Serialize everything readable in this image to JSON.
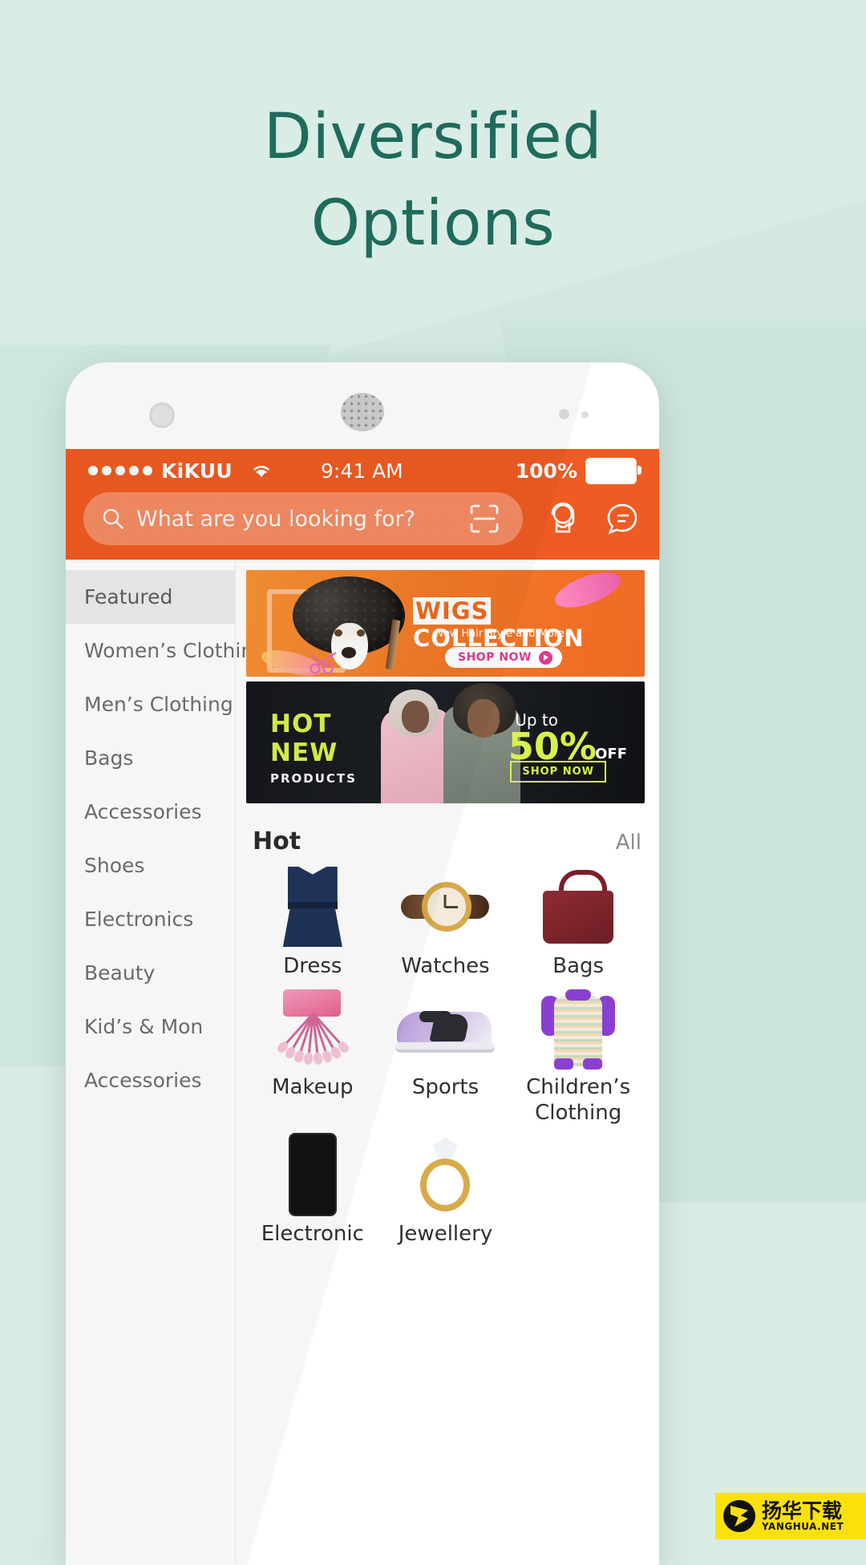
{
  "promo": {
    "headline_line1": "Diversified",
    "headline_line2": "Options",
    "headline_color": "#1f6b5c",
    "background_color": "#d9ece6"
  },
  "phone": {
    "status_bar": {
      "signal_dots": 5,
      "carrier": "KiKUU",
      "wifi_icon": "wifi-icon",
      "time": "9:41 AM",
      "battery_percent": "100%",
      "battery_icon": "battery-full-icon"
    },
    "appbar": {
      "accent_color": "#ef5b22",
      "search_placeholder": "What are you looking for?",
      "search_value": "",
      "search_icon": "search-icon",
      "scan_icon": "scan-barcode-icon",
      "support_icon": "headset-icon",
      "message_icon": "chat-bubble-icon"
    },
    "sidebar": {
      "items": [
        {
          "label": "Featured",
          "active": true
        },
        {
          "label": "Women’s Clothing",
          "active": false
        },
        {
          "label": "Men’s Clothing",
          "active": false
        },
        {
          "label": "Bags",
          "active": false
        },
        {
          "label": "Accessories",
          "active": false
        },
        {
          "label": "Shoes",
          "active": false
        },
        {
          "label": "Electronics",
          "active": false
        },
        {
          "label": "Beauty",
          "active": false
        },
        {
          "label": "Kid’s & Mon",
          "active": false
        },
        {
          "label": "Accessories",
          "active": false
        }
      ]
    },
    "banners": [
      {
        "name": "wigs-collection-banner",
        "title": "WIGS COLLECTION",
        "title_highlight": "WIGS",
        "title_rest": " COLLECTION",
        "subtitle": "New Hair Style and More",
        "cta": "SHOP NOW"
      },
      {
        "name": "hot-new-products-banner",
        "line1": "HOT",
        "line2": "NEW",
        "line3": "PRODUCTS",
        "upto": "Up to",
        "discount": "50%",
        "off": "OFF",
        "cta": "SHOP NOW"
      }
    ],
    "hot_section": {
      "title": "Hot",
      "all_link": "All",
      "items": [
        {
          "label": "Dress",
          "icon": "dress-thumbnail"
        },
        {
          "label": "Watches",
          "icon": "watch-thumbnail"
        },
        {
          "label": "Bags",
          "icon": "handbag-thumbnail"
        },
        {
          "label": "Makeup",
          "icon": "makeup-brushes-thumbnail"
        },
        {
          "label": "Sports",
          "icon": "sneaker-thumbnail"
        },
        {
          "label": "Children’s Clothing",
          "icon": "baby-romper-thumbnail"
        },
        {
          "label": "Electronic",
          "icon": "smartphone-thumbnail"
        },
        {
          "label": "Jewellery",
          "icon": "ring-thumbnail"
        }
      ]
    }
  },
  "watermark": {
    "line1": "扬华下载",
    "line2": "YANGHUA.NET"
  }
}
